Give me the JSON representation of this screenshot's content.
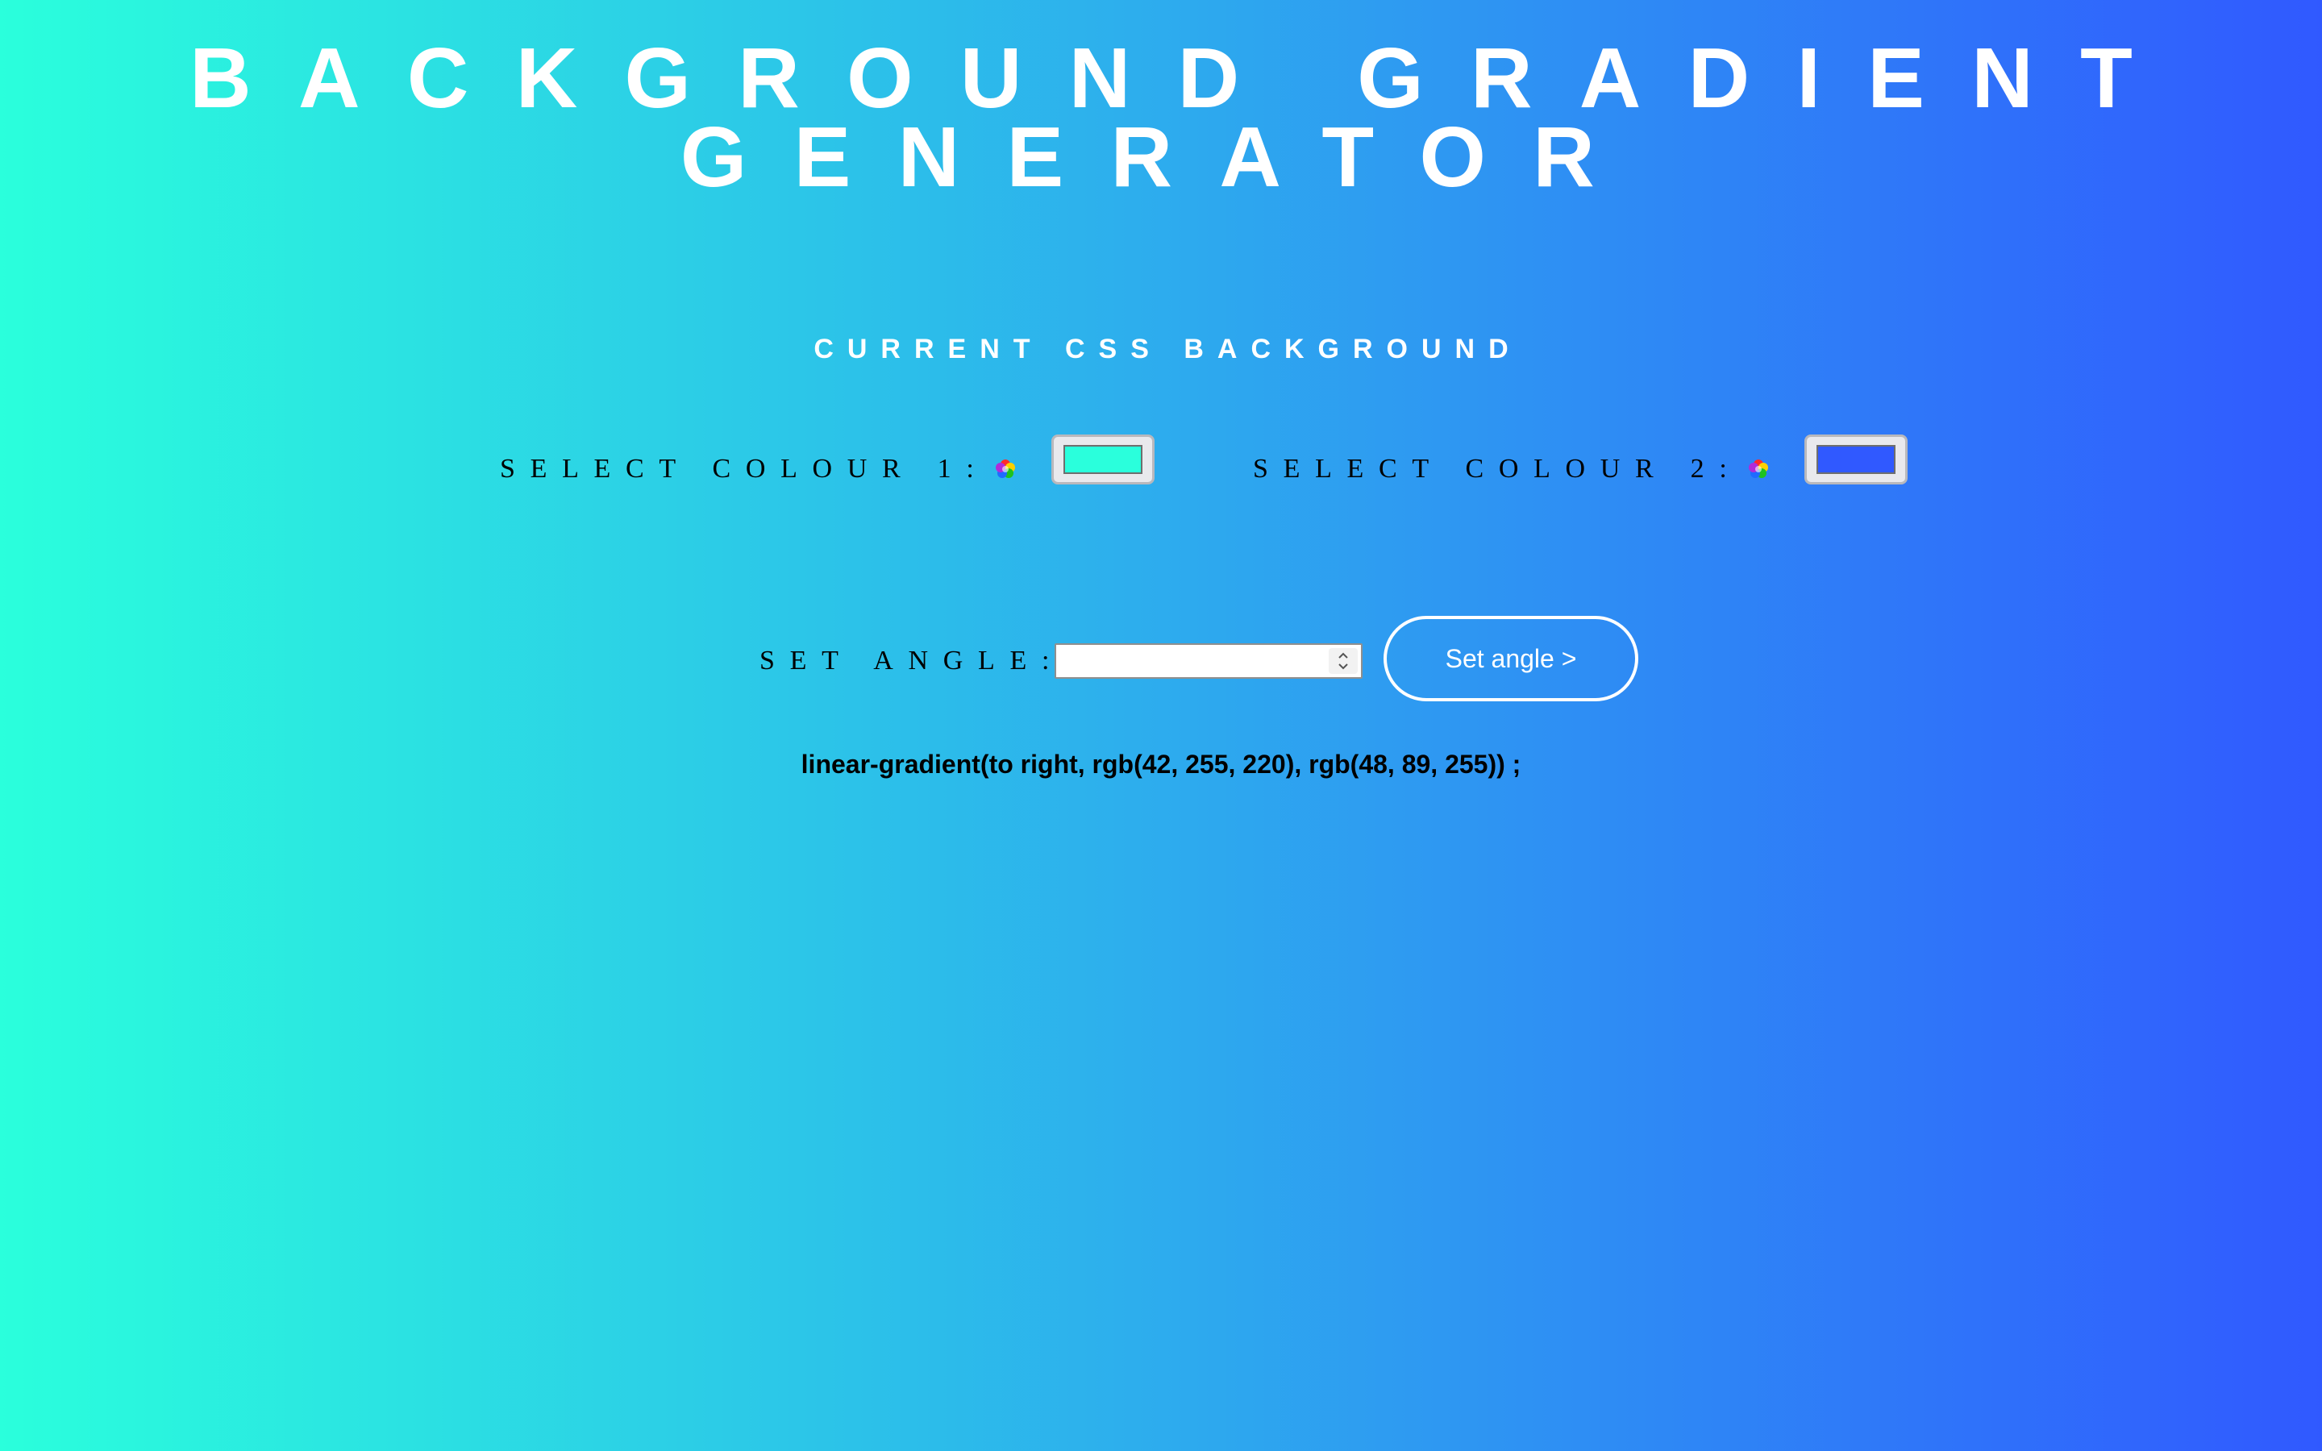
{
  "page": {
    "title_line1": "BACKGROUND GRADIENT",
    "title_line2": "GENERATOR",
    "subtitle": "CURRENT CSS BACKGROUND"
  },
  "colors": {
    "gradient_start": "#2affdc",
    "gradient_end": "#3059ff"
  },
  "colour1": {
    "label": "SELECT COLOUR 1:",
    "icon": "color-wheel-icon",
    "value": "#2affdc"
  },
  "colour2": {
    "label": "SELECT COLOUR 2:",
    "icon": "color-wheel-icon",
    "value": "#3059ff"
  },
  "angle": {
    "label": "SET ANGLE:",
    "input_value": "",
    "button_label": "Set angle >"
  },
  "css_output": "linear-gradient(to right, rgb(42, 255, 220), rgb(48, 89, 255)) ;"
}
